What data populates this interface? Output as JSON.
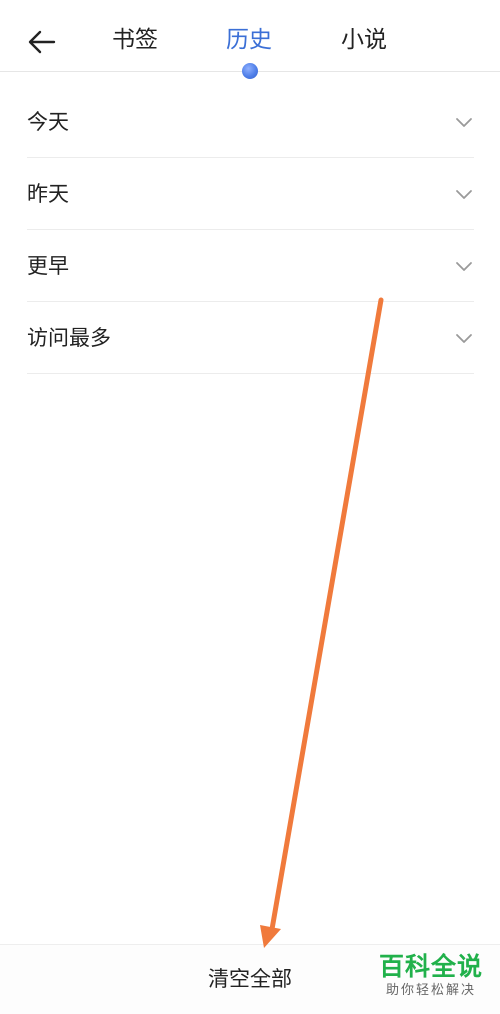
{
  "header": {
    "back_icon": "arrow-left-icon",
    "tabs": [
      {
        "label": "书签",
        "active": false
      },
      {
        "label": "历史",
        "active": true
      },
      {
        "label": "小说",
        "active": false
      }
    ]
  },
  "history_groups": [
    {
      "label": "今天",
      "icon": "chevron-down-icon"
    },
    {
      "label": "昨天",
      "icon": "chevron-down-icon"
    },
    {
      "label": "更早",
      "icon": "chevron-down-icon"
    },
    {
      "label": "访问最多",
      "icon": "chevron-down-icon"
    }
  ],
  "footer": {
    "clear_all_label": "清空全部"
  },
  "watermark": {
    "title": "百科全说",
    "subtitle": "助你轻松解决"
  },
  "colors": {
    "accent": "#3b6fd6",
    "annotation_arrow": "#f07a3c",
    "watermark_green": "#21b14b"
  }
}
